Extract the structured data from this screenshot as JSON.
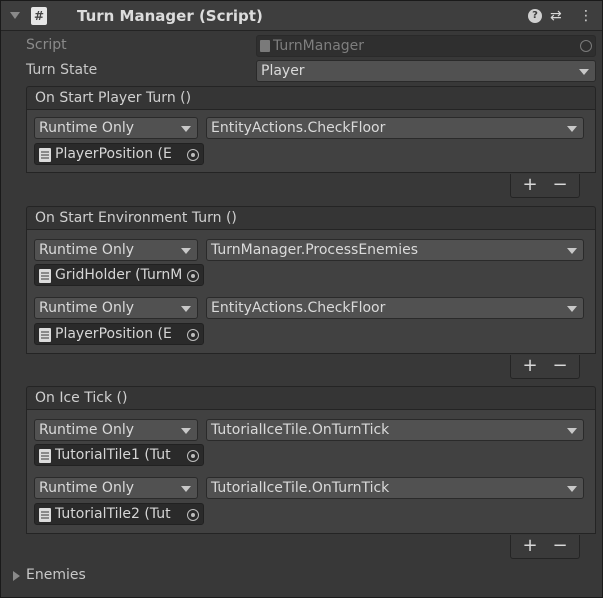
{
  "component": {
    "title": "Turn Manager (Script)",
    "script_label": "Script",
    "script_value": "TurnManager",
    "turn_state_label": "Turn State",
    "turn_state_value": "Player"
  },
  "header_icons": [
    "help-icon",
    "sliders-icon",
    "kebab-menu-icon"
  ],
  "events": [
    {
      "title": "On Start Player Turn ()",
      "listeners": [
        {
          "mode": "Runtime Only",
          "function": "EntityActions.CheckFloor",
          "object": "PlayerPosition (E"
        }
      ]
    },
    {
      "title": "On Start Environment Turn ()",
      "listeners": [
        {
          "mode": "Runtime Only",
          "function": "TurnManager.ProcessEnemies",
          "object": "GridHolder (TurnM"
        },
        {
          "mode": "Runtime Only",
          "function": "EntityActions.CheckFloor",
          "object": "PlayerPosition (E"
        }
      ]
    },
    {
      "title": "On Ice Tick ()",
      "listeners": [
        {
          "mode": "Runtime Only",
          "function": "TutorialIceTile.OnTurnTick",
          "object": "TutorialTile1 (Tut"
        },
        {
          "mode": "Runtime Only",
          "function": "TutorialIceTile.OnTurnTick",
          "object": "TutorialTile2 (Tut"
        }
      ]
    }
  ],
  "buttons": {
    "plus": "+",
    "minus": "−"
  },
  "enemies_label": "Enemies"
}
